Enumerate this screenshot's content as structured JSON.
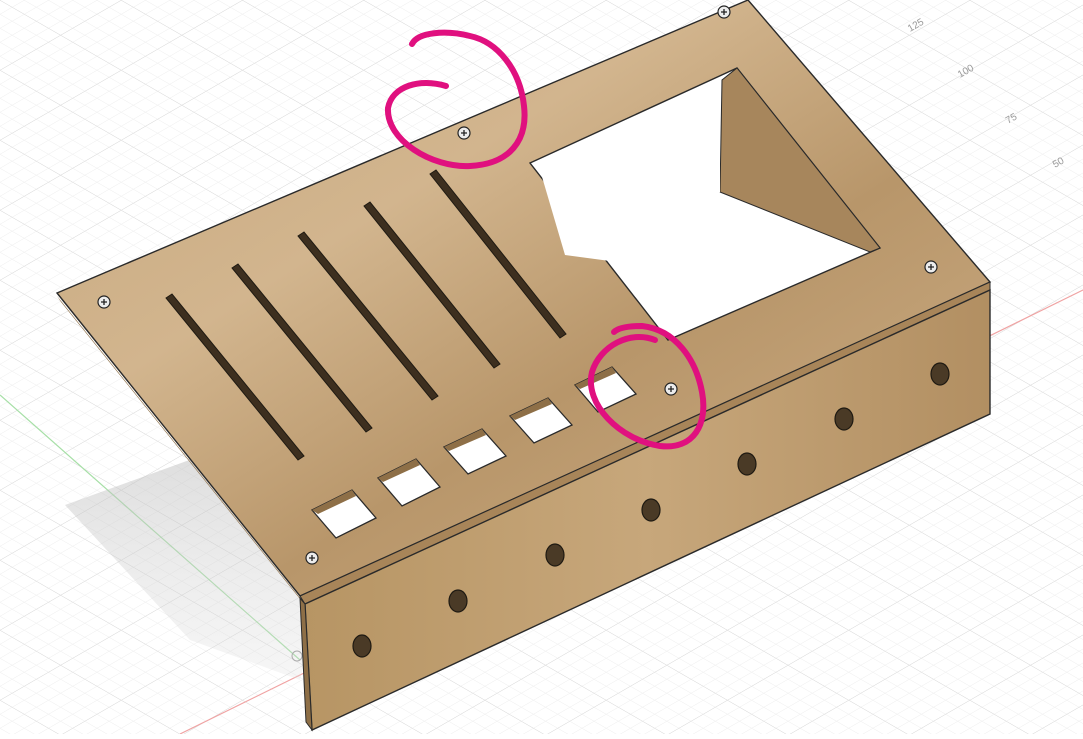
{
  "viewport": {
    "grid_labels": [
      "125",
      "100",
      "75",
      "50"
    ]
  },
  "colors": {
    "wood_top": "#c9a97f",
    "wood_side": "#b89668",
    "wood_dark": "#8e6f47",
    "annotation": "#e0107f",
    "grid_minor": "#ececec",
    "grid_major": "#d9d9d9",
    "axis_x": "#f2a0a0",
    "axis_y": "#9fe09f"
  },
  "model": {
    "slots": 5,
    "square_buttons": 5,
    "side_holes": 7,
    "screws": 6,
    "annotations": 2
  }
}
